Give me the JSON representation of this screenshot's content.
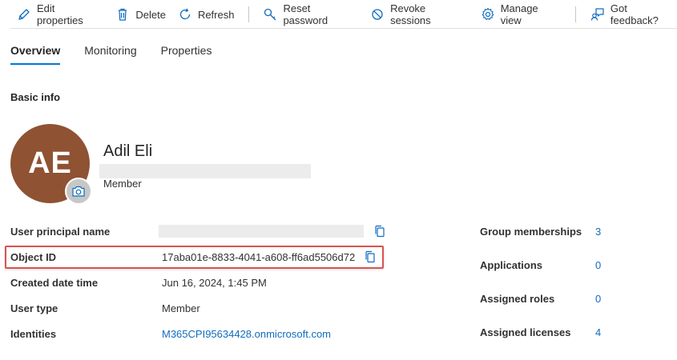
{
  "toolbar": {
    "edit_label": "Edit properties",
    "delete_label": "Delete",
    "refresh_label": "Refresh",
    "reset_password_label": "Reset password",
    "revoke_sessions_label": "Revoke sessions",
    "manage_view_label": "Manage view",
    "feedback_label": "Got feedback?"
  },
  "tabs": [
    {
      "label": "Overview",
      "active": true
    },
    {
      "label": "Monitoring",
      "active": false
    },
    {
      "label": "Properties",
      "active": false
    }
  ],
  "basic_info": {
    "title": "Basic info",
    "initials": "AE",
    "name": "Adil Eli",
    "role": "Member"
  },
  "properties": [
    {
      "label": "User principal name",
      "value": ""
    },
    {
      "label": "Object ID",
      "value": "17aba01e-8833-4041-a608-ff6ad5506d72"
    },
    {
      "label": "Created date time",
      "value": "Jun 16, 2024, 1:45 PM"
    },
    {
      "label": "User type",
      "value": "Member"
    },
    {
      "label": "Identities",
      "value": "M365CPI95634428.onmicrosoft.com"
    }
  ],
  "stats": [
    {
      "label": "Group memberships",
      "value": "3"
    },
    {
      "label": "Applications",
      "value": "0"
    },
    {
      "label": "Assigned roles",
      "value": "0"
    },
    {
      "label": "Assigned licenses",
      "value": "4"
    }
  ],
  "colors": {
    "accent": "#0078d4",
    "link": "#0f6cbd",
    "avatar": "#8f5233",
    "highlight": "#d9534f"
  }
}
